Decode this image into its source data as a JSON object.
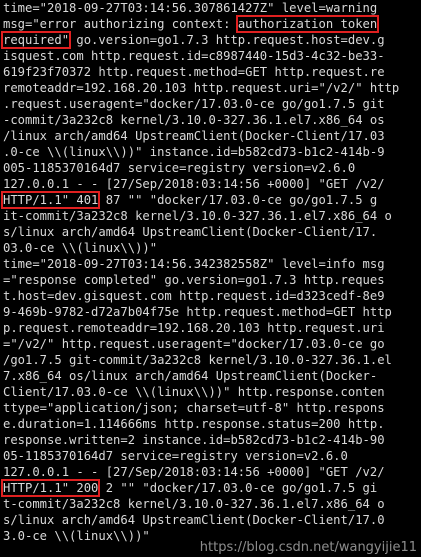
{
  "theme": {
    "background": "#000000",
    "text": "#d9d9d9",
    "highlight_box": "#e02020"
  },
  "lines": [
    {
      "text": "time=\"2018-09-27T03:14:56.307861427Z\" level=warning"
    },
    {
      "pre": "msg=\"error authorizing context: ",
      "hl": "authorization token",
      "post": ""
    },
    {
      "pre": "",
      "hl": "required\"",
      "post": " go.version=go1.7.3 http.request.host=dev.g"
    },
    {
      "text": "isquest.com http.request.id=c8987440-15d3-4c32-be33-"
    },
    {
      "text": "619f23f70372 http.request.method=GET http.request.re"
    },
    {
      "text": "remoteaddr=192.168.20.103 http.request.uri=\"/v2/\" http"
    },
    {
      "text": ".request.useragent=\"docker/17.03.0-ce go/go1.7.5 git"
    },
    {
      "text": "-commit/3a232c8 kernel/3.10.0-327.36.1.el7.x86_64 os"
    },
    {
      "text": "/linux arch/amd64 UpstreamClient(Docker-Client/17.03"
    },
    {
      "text": ".0-ce \\\\(linux\\\\))\" instance.id=b582cd73-b1c2-414b-9"
    },
    {
      "text": "005-1185370164d7 service=registry version=v2.6.0"
    },
    {
      "text": "127.0.0.1 - - [27/Sep/2018:03:14:56 +0000] \"GET /v2/"
    },
    {
      "pre": "",
      "hl": "HTTP/1.1\" 401",
      "post": " 87 \"\" \"docker/17.03.0-ce go/go1.7.5 g"
    },
    {
      "text": "it-commit/3a232c8 kernel/3.10.0-327.36.1.el7.x86_64 o"
    },
    {
      "text": "s/linux arch/amd64 UpstreamClient(Docker-Client/17."
    },
    {
      "text": "03.0-ce \\\\(linux\\\\))\""
    },
    {
      "text": "time=\"2018-09-27T03:14:56.342382558Z\" level=info msg"
    },
    {
      "text": "=\"response completed\" go.version=go1.7.3 http.reques"
    },
    {
      "text": "t.host=dev.gisquest.com http.request.id=d323cedf-8e9"
    },
    {
      "text": "9-469b-9782-d72a7b04f75e http.request.method=GET http"
    },
    {
      "text": "p.request.remoteaddr=192.168.20.103 http.request.uri"
    },
    {
      "text": "=\"/v2/\" http.request.useragent=\"docker/17.03.0-ce go"
    },
    {
      "text": "/go1.7.5 git-commit/3a232c8 kernel/3.10.0-327.36.1.el"
    },
    {
      "text": "7.x86_64 os/linux arch/amd64 UpstreamClient(Docker-"
    },
    {
      "text": "Client/17.03.0-ce \\\\(linux\\\\))\" http.response.conten"
    },
    {
      "text": "ttype=\"application/json; charset=utf-8\" http.respons"
    },
    {
      "text": "e.duration=1.114666ms http.response.status=200 http."
    },
    {
      "text": "response.written=2 instance.id=b582cd73-b1c2-414b-90"
    },
    {
      "text": "05-1185370164d7 service=registry version=v2.6.0"
    },
    {
      "text": "127.0.0.1 - - [27/Sep/2018:03:14:56 +0000] \"GET /v2/"
    },
    {
      "pre": "",
      "hl": "HTTP/1.1\" 200",
      "post": " 2 \"\" \"docker/17.03.0-ce go/go1.7.5 gi"
    },
    {
      "text": "t-commit/3a232c8 kernel/3.10.0-327.36.1.el7.x86_64 o"
    },
    {
      "text": "s/linux arch/amd64 UpstreamClient(Docker-Client/17.0"
    },
    {
      "text": "3.0-ce \\\\(linux\\\\))\""
    }
  ],
  "watermark": "https://blog.csdn.net/wangyijie11"
}
